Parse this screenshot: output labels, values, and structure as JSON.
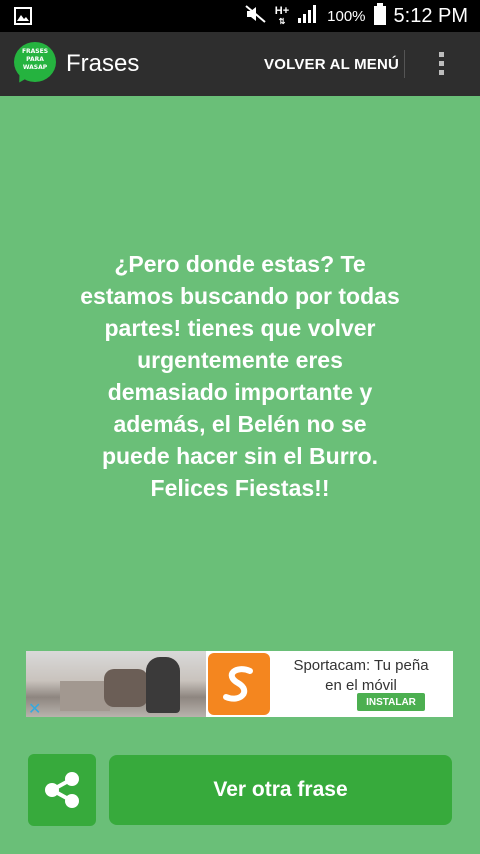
{
  "status_bar": {
    "network": "H+",
    "battery": "100%",
    "time": "5:12 PM",
    "icons": [
      "image-icon",
      "mute-icon",
      "signal-icon",
      "battery-icon"
    ]
  },
  "app_bar": {
    "logo_text": [
      "FRASES",
      "PARA",
      "WASAP"
    ],
    "title": "Frases",
    "menu_action": "VOLVER AL MENÚ",
    "overflow_icon": "overflow-menu-icon"
  },
  "quote": {
    "text": "¿Pero donde estas? Te estamos buscando por todas partes! tienes que volver urgentemente eres demasiado importante y además, el Belén no se puede hacer sin el Burro. Felices Fiestas!!"
  },
  "ad": {
    "line1": "Sportacam: Tu peña",
    "line2": "en el móvil",
    "install_label": "INSTALAR",
    "close_icon": "ad-close-icon",
    "logo_color": "#f4861f"
  },
  "actions": {
    "share_icon": "share-icon",
    "next_label": "Ver otra frase"
  },
  "colors": {
    "background": "#6abf78",
    "appbar": "#2e2e2e",
    "button": "#37aa3c"
  }
}
